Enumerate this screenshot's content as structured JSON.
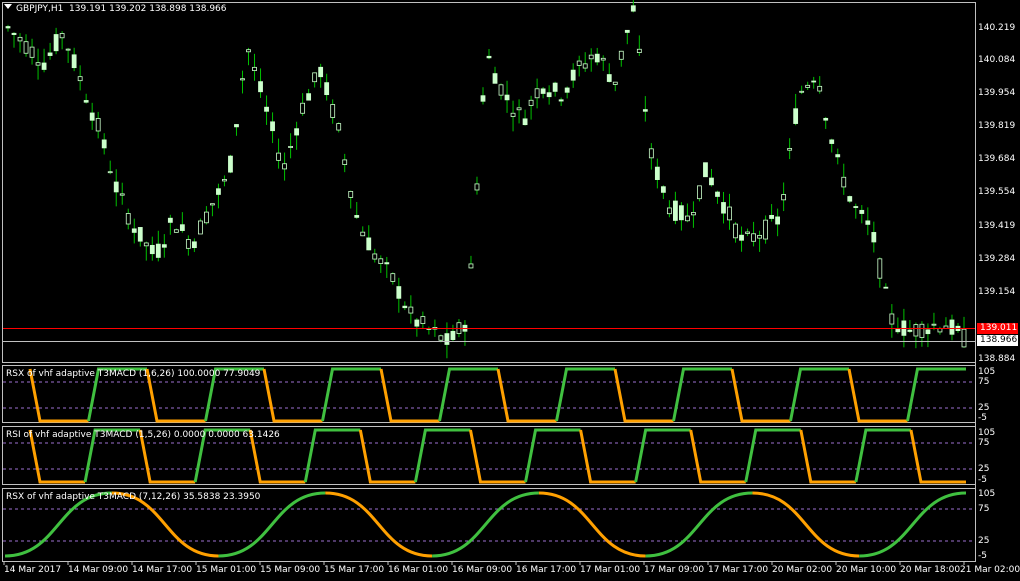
{
  "symbol_header": {
    "symbol": "GBPJPY,H1",
    "ohlc": "139.191 139.202 138.898 138.966"
  },
  "colors": {
    "background": "#000000",
    "candle": "#ccffcc",
    "wick": "#00c000",
    "bid_line": "#ff0000",
    "price_line": "#c0c0c0",
    "grid_levels": "#9d6fd0",
    "rsx_up": "#40c040",
    "rsx_down": "#ffa000"
  },
  "price_axis": {
    "labels": [
      "140.219",
      "140.084",
      "139.954",
      "139.819",
      "139.684",
      "139.554",
      "139.419",
      "139.284",
      "139.154",
      "138.884"
    ],
    "bid_tag": "139.011",
    "last_tag": "138.966"
  },
  "indicators": [
    {
      "title": "RSX of vhf adaptive T3MACD (1,6,26) 100.0000 77.9049",
      "levels": [
        "105",
        "75",
        "25",
        "-5"
      ]
    },
    {
      "title": "RSI of vhf adaptive T3MACD (1,5,26) 0.0000 0.0000 63.1426",
      "levels": [
        "105",
        "75",
        "25",
        "-5"
      ]
    },
    {
      "title": "RSX of vhf adaptive T3MACD (7,12,26) 35.5838 23.3950",
      "levels": [
        "105",
        "75",
        "25",
        "-5"
      ]
    }
  ],
  "time_axis": [
    "14 Mar 2017",
    "14 Mar 09:00",
    "14 Mar 17:00",
    "15 Mar 01:00",
    "15 Mar 09:00",
    "15 Mar 17:00",
    "16 Mar 01:00",
    "16 Mar 09:00",
    "16 Mar 17:00",
    "17 Mar 01:00",
    "17 Mar 09:00",
    "17 Mar 17:00",
    "20 Mar 02:00",
    "20 Mar 10:00",
    "20 Mar 18:00",
    "21 Mar 02:00"
  ],
  "chart_data": {
    "type": "candlestick",
    "ylim": [
      138.88,
      140.32
    ],
    "series_close_approx": [
      140.22,
      140.15,
      140.08,
      140.2,
      140.0,
      139.8,
      139.55,
      139.4,
      139.3,
      139.45,
      139.35,
      139.5,
      139.62,
      140.15,
      139.9,
      139.65,
      139.9,
      140.05,
      139.8,
      139.45,
      139.3,
      139.2,
      139.05,
      139.0,
      138.95,
      139.05,
      140.12,
      139.95,
      139.85,
      140.0,
      139.95,
      140.05,
      140.12,
      140.0,
      140.3,
      139.7,
      139.5,
      139.45,
      139.65,
      139.5,
      139.35,
      139.4,
      139.45,
      139.95,
      140.05,
      139.7,
      139.5,
      139.4,
      139.05,
      139.0,
      139.02,
      139.03,
      138.97
    ],
    "oscillator_1_segments": [
      "down",
      "up",
      "down",
      "up",
      "down",
      "up",
      "down",
      "up",
      "down",
      "up",
      "down",
      "up",
      "down",
      "up",
      "down",
      "up"
    ],
    "oscillator_2_segments": [
      "down",
      "up",
      "down",
      "up",
      "down",
      "up",
      "down",
      "up",
      "down",
      "up",
      "down",
      "up",
      "down",
      "up",
      "down",
      "up",
      "down"
    ],
    "oscillator_3_segments": [
      "up",
      "down",
      "up",
      "down",
      "up",
      "down",
      "up",
      "down",
      "up"
    ]
  }
}
